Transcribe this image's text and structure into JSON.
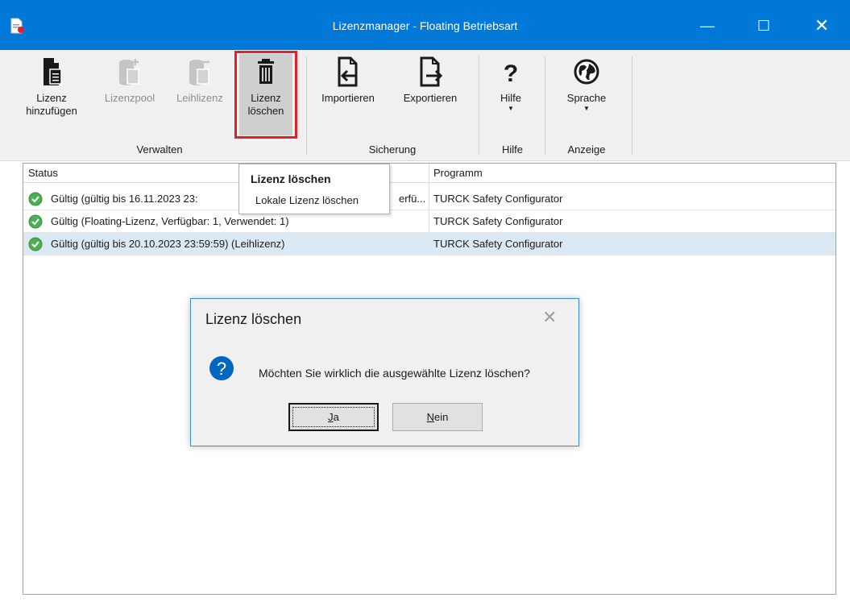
{
  "window": {
    "title": "Lizenzmanager - Floating Betriebsart",
    "controls": {
      "minimize": "—",
      "maximize": "☐",
      "close": "✕"
    }
  },
  "ribbon": {
    "buttons": [
      {
        "icon": "add-license-icon",
        "label1": "Lizenz",
        "label2": "hinzufügen",
        "enabled": true
      },
      {
        "icon": "license-pool-icon",
        "label1": "Lizenzpool",
        "enabled": false
      },
      {
        "icon": "loan-license-icon",
        "label1": "Leihlizenz",
        "enabled": false
      },
      {
        "icon": "trash-icon",
        "label1": "Lizenz",
        "label2": "löschen",
        "enabled": true,
        "highlighted": true
      },
      {
        "icon": "import-icon",
        "label1": "Importieren",
        "enabled": true
      },
      {
        "icon": "export-icon",
        "label1": "Exportieren",
        "enabled": true
      },
      {
        "icon": "help-icon",
        "label1": "Hilfe",
        "dropdown": true,
        "enabled": true
      },
      {
        "icon": "globe-icon",
        "label1": "Sprache",
        "dropdown": true,
        "enabled": true
      }
    ],
    "groups": [
      "Verwalten",
      "Sicherung",
      "Hilfe",
      "Anzeige"
    ],
    "highlight_color": "#e0202a"
  },
  "table": {
    "headers": [
      "Status",
      "Programm"
    ],
    "rows": [
      {
        "status": "Gültig (gültig bis 16.11.2023 23:",
        "status_tail": "erfü...",
        "program": "TURCK Safety Configurator",
        "selected": false
      },
      {
        "status": "Gültig (Floating-Lizenz, Verfügbar: 1, Verwendet: 1)",
        "program": "TURCK Safety Configurator",
        "selected": false
      },
      {
        "status": "Gültig (gültig bis 20.10.2023 23:59:59) (Leihlizenz)",
        "program": "TURCK Safety Configurator",
        "selected": true
      }
    ]
  },
  "dropdown_menu": {
    "title": "Lizenz löschen",
    "item": "Lokale Lizenz löschen"
  },
  "dialog": {
    "title": "Lizenz löschen",
    "message": "Möchten Sie wirklich die ausgewählte Lizenz löschen?",
    "yes_mnemonic": "J",
    "yes_rest": "a",
    "no_mnemonic": "N",
    "no_rest": "ein",
    "accent": "#0067c0"
  }
}
